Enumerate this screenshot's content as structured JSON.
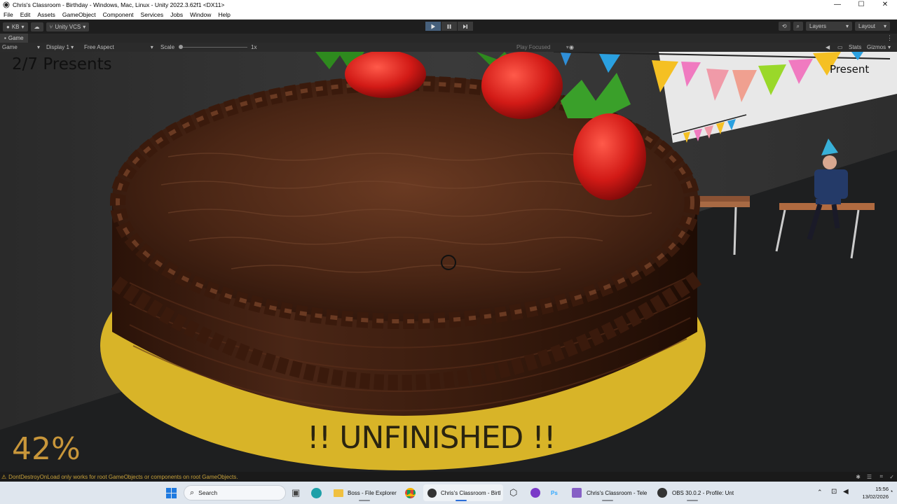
{
  "window": {
    "title": "Chris's Classroom - Birthday - Windows, Mac, Linux - Unity 2022.3.62f1 <DX11>",
    "controls": {
      "minimize": "—",
      "maximize": "☐",
      "close": "✕"
    }
  },
  "menu": [
    "File",
    "Edit",
    "Assets",
    "GameObject",
    "Component",
    "Services",
    "Jobs",
    "Window",
    "Help"
  ],
  "toolbar": {
    "account": "KB",
    "vcs": "Unity VCS",
    "layers": "Layers",
    "layout": "Layout"
  },
  "tab": {
    "label": "Game"
  },
  "gamebar": {
    "mode": "Game",
    "display": "Display 1",
    "aspect": "Free Aspect",
    "scale_label": "Scale",
    "scale_value": "1x",
    "play_focused": "Play Focused",
    "stats": "Stats",
    "gizmos": "Gizmos"
  },
  "game": {
    "presents_counter": "2/7 Presents",
    "present_label": "Present",
    "progress": "42%",
    "banner": "!! UNFINISHED !!"
  },
  "status": {
    "message": "DontDestroyOnLoad only works for root GameObjects or components on root GameObjects."
  },
  "taskbar": {
    "search": "Search",
    "apps": [
      {
        "label": "Boss - File Explorer"
      },
      {
        "label": "Chris's Classroom - Birtl"
      },
      {
        "label": "Chris's Classroom - Tele"
      },
      {
        "label": "OBS 30.0.2 - Profile: Unt"
      }
    ],
    "clock": {
      "time": "15:56",
      "date": "13/02/2026"
    }
  },
  "colors": {
    "play_active": "#46607c",
    "hud_orange": "#c8963a",
    "taskbar_bg": "#dfe6ee"
  }
}
